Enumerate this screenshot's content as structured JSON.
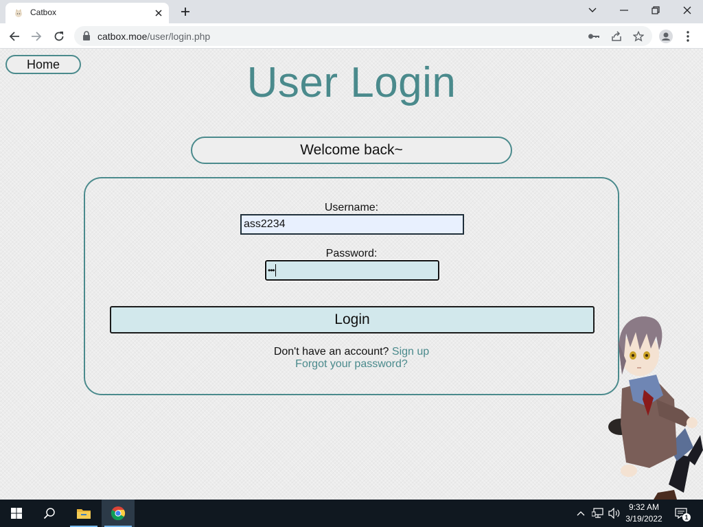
{
  "browser": {
    "tab_title": "Catbox",
    "url_host": "catbox.moe",
    "url_path": "/user/login.php"
  },
  "page": {
    "home_label": "Home",
    "title": "User Login",
    "welcome": "Welcome back~",
    "username_label": "Username:",
    "username_value": "ass2234",
    "password_label": "Password:",
    "password_mask": "•••",
    "login_label": "Login",
    "signup_prompt": "Don't have an account?",
    "signup_link": "Sign up",
    "forgot_link": "Forgot your password?"
  },
  "taskbar": {
    "time": "9:32 AM",
    "date": "3/19/2022",
    "notification_count": "1"
  },
  "colors": {
    "accent": "#4a8a8c",
    "input_fill": "#d2e8ec",
    "autofill": "#e8f0fe",
    "taskbar": "#101820"
  },
  "icons": {
    "tab": "catbox-favicon",
    "toolbar": [
      "back-icon",
      "forward-icon",
      "reload-icon",
      "lock-icon",
      "key-icon",
      "share-icon",
      "star-icon",
      "profile-icon",
      "menu-icon"
    ],
    "taskbar": [
      "windows-start-icon",
      "search-icon",
      "file-explorer-icon",
      "chrome-icon"
    ],
    "tray": [
      "chevron-up-icon",
      "network-icon",
      "volume-icon",
      "notification-icon"
    ]
  }
}
